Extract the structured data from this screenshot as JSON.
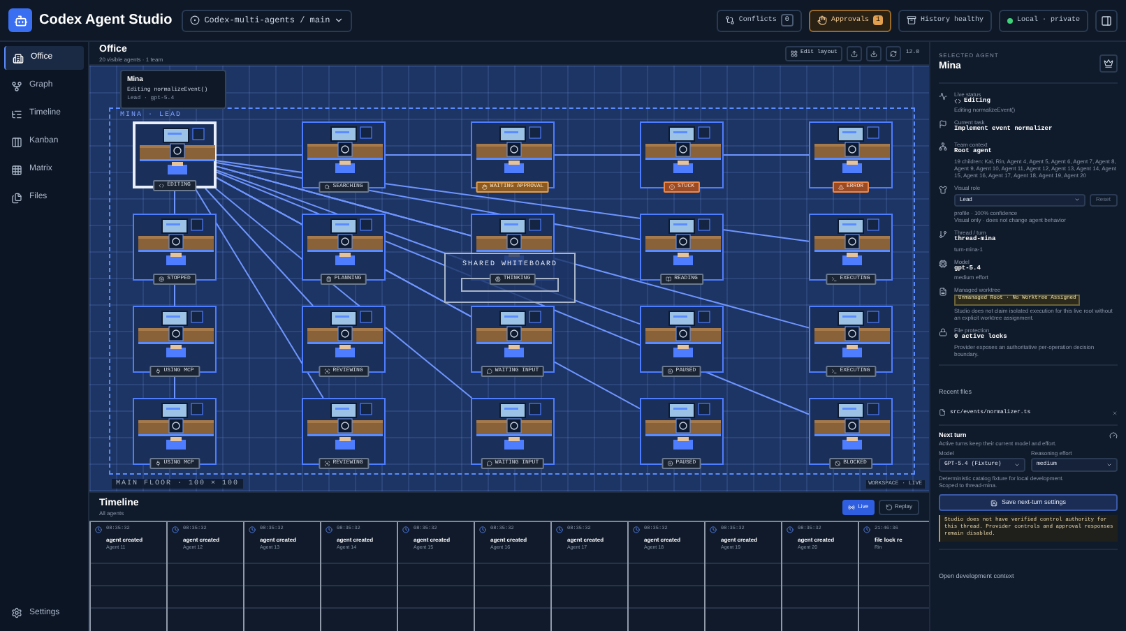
{
  "app": {
    "title": "Codex Agent Studio",
    "branch": "Codex-multi-agents / main"
  },
  "header_actions": [
    {
      "kind": "conflicts",
      "label": "Conflicts",
      "count": "0"
    },
    {
      "kind": "approvals",
      "label": "Approvals",
      "count": "1"
    },
    {
      "kind": "history",
      "label": "History healthy"
    },
    {
      "kind": "local",
      "label": "Local · private"
    }
  ],
  "sidebar": {
    "items": [
      {
        "kind": "office",
        "label": "Office",
        "selected": true
      },
      {
        "kind": "graph",
        "label": "Graph",
        "selected": false
      },
      {
        "kind": "timeline",
        "label": "Timeline",
        "selected": false
      },
      {
        "kind": "kanban",
        "label": "Kanban",
        "selected": false
      },
      {
        "kind": "matrix",
        "label": "Matrix",
        "selected": false
      },
      {
        "kind": "files",
        "label": "Files",
        "selected": false
      }
    ],
    "footer": "Settings"
  },
  "office": {
    "title": "Office",
    "subtitle": "20 visible agents · 1 team",
    "edit_label": "Edit layout",
    "zoom": "12.0",
    "zone_label": "MINA · LEAD",
    "tooltip": {
      "name": "Mina",
      "activity": "Editing normalizeEvent()",
      "meta": "Lead · gpt-5.4"
    },
    "whiteboard": "SHARED WHITEBOARD",
    "floor_label": "MAIN FLOOR · 100 × 100",
    "live_label": "WORKSPACE · LIVE",
    "agents": [
      {
        "selected": true,
        "kind": "editing",
        "status": "EDITING"
      },
      {
        "selected": false,
        "kind": "searching",
        "status": "SEARCHING"
      },
      {
        "selected": false,
        "kind": "waiting_approval",
        "status": "WAITING APPROVAL"
      },
      {
        "selected": false,
        "kind": "stuck",
        "status": "STUCK"
      },
      {
        "selected": false,
        "kind": "error",
        "status": "ERROR"
      },
      {
        "selected": false,
        "kind": "stopped",
        "status": "STOPPED"
      },
      {
        "selected": false,
        "kind": "planning",
        "status": "PLANNING"
      },
      {
        "selected": false,
        "kind": "thinking",
        "status": "THINKING"
      },
      {
        "selected": false,
        "kind": "reading",
        "status": "READING"
      },
      {
        "selected": false,
        "kind": "executing",
        "status": "EXECUTING"
      },
      {
        "selected": false,
        "kind": "mcp",
        "status": "USING MCP"
      },
      {
        "selected": false,
        "kind": "reviewing",
        "status": "REVIEWING"
      },
      {
        "selected": false,
        "kind": "waiting_input",
        "status": "WAITING INPUT"
      },
      {
        "selected": false,
        "kind": "paused",
        "status": "PAUSED"
      },
      {
        "selected": false,
        "kind": "executing",
        "status": "EXECUTING"
      },
      {
        "selected": false,
        "kind": "mcp",
        "status": "USING MCP"
      },
      {
        "selected": false,
        "kind": "reviewing",
        "status": "REVIEWING"
      },
      {
        "selected": false,
        "kind": "waiting_input",
        "status": "WAITING INPUT"
      },
      {
        "selected": false,
        "kind": "paused",
        "status": "PAUSED"
      },
      {
        "selected": false,
        "kind": "blocked",
        "status": "BLOCKED"
      }
    ]
  },
  "timeline": {
    "title": "Timeline",
    "subtitle": "All agents",
    "live": {
      "label": "Live",
      "selected": true
    },
    "replay": {
      "label": "Replay",
      "selected": false
    },
    "events": [
      {
        "time": "08:35:32",
        "title": "agent created",
        "agent": "Agent 11"
      },
      {
        "time": "08:35:32",
        "title": "agent created",
        "agent": "Agent 12"
      },
      {
        "time": "08:35:32",
        "title": "agent created",
        "agent": "Agent 13"
      },
      {
        "time": "08:35:32",
        "title": "agent created",
        "agent": "Agent 14"
      },
      {
        "time": "08:35:32",
        "title": "agent created",
        "agent": "Agent 15"
      },
      {
        "time": "08:35:32",
        "title": "agent created",
        "agent": "Agent 16"
      },
      {
        "time": "08:35:32",
        "title": "agent created",
        "agent": "Agent 17"
      },
      {
        "time": "08:35:32",
        "title": "agent created",
        "agent": "Agent 18"
      },
      {
        "time": "08:35:32",
        "title": "agent created",
        "agent": "Agent 19"
      },
      {
        "time": "08:35:32",
        "title": "agent created",
        "agent": "Agent 20"
      },
      {
        "time": "21:46:36",
        "title": "file lock re",
        "agent": "Rin"
      }
    ]
  },
  "inspector": {
    "eyebrow": "SELECTED AGENT",
    "name": "Mina",
    "sections": [
      {
        "kind": "live",
        "label": "Live status",
        "value": "Editing",
        "notes": [
          "Editing normalizeEvent()"
        ]
      },
      {
        "kind": "task",
        "label": "Current task",
        "value": "Implement event normalizer"
      },
      {
        "kind": "team",
        "label": "Team context",
        "value": "Root agent",
        "notes": [
          "19 children: Kai, Rin, Agent 4, Agent 5, Agent 6, Agent 7, Agent 8, Agent 9, Agent 10, Agent 11, Agent 12, Agent 13, Agent 14, Agent 15, Agent 16, Agent 17, Agent 18, Agent 19, Agent 20"
        ]
      },
      {
        "kind": "role",
        "label": "Visual role",
        "select": "Lead",
        "reset": "Reset",
        "notes": [
          "profile · 100% confidence",
          "Visual only · does not change agent behavior"
        ]
      },
      {
        "kind": "thread",
        "label": "Thread / turn",
        "value": "thread-mina",
        "notes": [
          "turn-mina-1"
        ]
      },
      {
        "kind": "model",
        "label": "Model",
        "value": "gpt-5.4",
        "notes": [
          "medium effort"
        ]
      },
      {
        "kind": "worktree",
        "label": "Managed worktree",
        "badge": "Unmanaged Root · No Worktree Assigned",
        "notes": [
          "Studio does not claim isolated execution for this live root without an explicit worktree assignment."
        ]
      },
      {
        "kind": "locks",
        "label": "File protection",
        "value": "0 active locks",
        "notes": [
          "Provider exposes an authoritative per-operation decision boundary."
        ]
      }
    ],
    "recent_files": {
      "title": "Recent files",
      "files": [
        "src/events/normalizer.ts"
      ]
    },
    "next_turn": {
      "title": "Next turn",
      "note": "Active turns keep their current model and effort.",
      "model_label": "Model",
      "model": "GPT-5.4 (Fixture)",
      "effort_label": "Reasoning effort",
      "effort": "medium",
      "notes": [
        "Deterministic catalog fixture for local development.",
        "Scoped to thread-mina."
      ],
      "save": "Save next-turn settings",
      "warning": "Studio does not have verified control authority for this thread. Provider controls and approval responses remain disabled."
    },
    "open_context": "Open development context"
  }
}
